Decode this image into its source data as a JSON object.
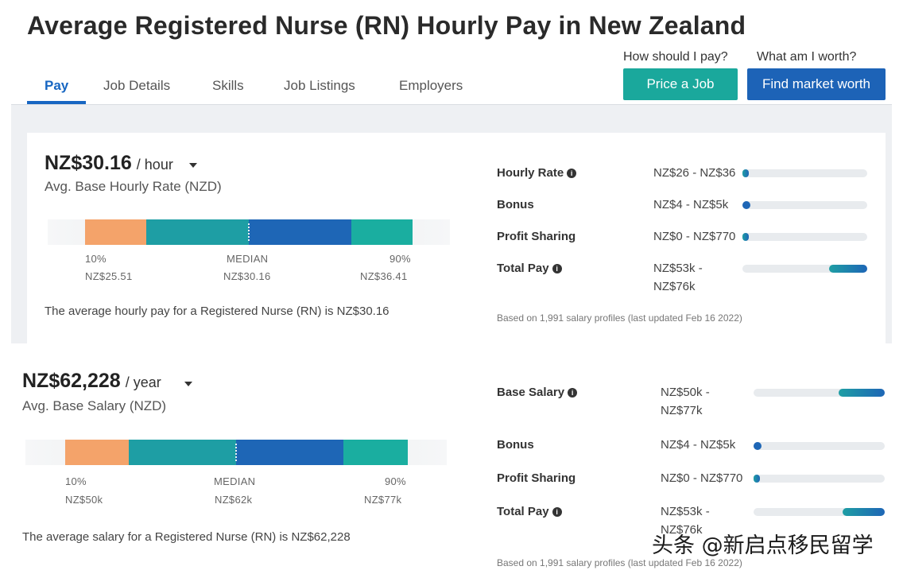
{
  "page": {
    "title": "Average Registered Nurse (RN) Hourly Pay in New Zealand"
  },
  "tabs": [
    {
      "label": "Pay",
      "active": true
    },
    {
      "label": "Job Details",
      "active": false
    },
    {
      "label": "Skills",
      "active": false
    },
    {
      "label": "Job Listings",
      "active": false
    },
    {
      "label": "Employers",
      "active": false
    }
  ],
  "cta": {
    "price_question": "How should I pay?",
    "price_button": "Price a Job",
    "worth_question": "What am I worth?",
    "worth_button": "Find market worth"
  },
  "hourly": {
    "value": "NZ$30.16",
    "unit": "/ hour",
    "label": "Avg. Base Hourly Rate (NZD)",
    "p10_label": "10%",
    "median_label": "MEDIAN",
    "p90_label": "90%",
    "p10_value": "NZ$25.51",
    "median_value": "NZ$30.16",
    "p90_value": "NZ$36.41",
    "summary": "The average hourly pay for a Registered Nurse (RN) is NZ$30.16",
    "rows": [
      {
        "label": "Hourly Rate",
        "info": true,
        "range": "NZ$26 - NZ$36",
        "fill_start": 0.0,
        "fill_end": 0.05
      },
      {
        "label": "Bonus",
        "info": false,
        "range": "NZ$4 - NZ$5k",
        "fill_start": 0.0,
        "fill_end": 0.07
      },
      {
        "label": "Profit Sharing",
        "info": false,
        "range": "NZ$0 - NZ$770",
        "fill_start": 0.0,
        "fill_end": 0.05
      },
      {
        "label": "Total Pay",
        "info": true,
        "range": "NZ$53k -\nNZ$76k",
        "fill_start": 0.7,
        "fill_end": 1.0
      }
    ],
    "footnote": "Based on 1,991 salary profiles (last updated Feb 16 2022)"
  },
  "annual": {
    "value": "NZ$62,228",
    "unit": "/ year",
    "label": "Avg. Base Salary (NZD)",
    "p10_label": "10%",
    "median_label": "MEDIAN",
    "p90_label": "90%",
    "p10_value": "NZ$50k",
    "median_value": "NZ$62k",
    "p90_value": "NZ$77k",
    "summary": "The average salary for a Registered Nurse (RN) is NZ$62,228",
    "rows": [
      {
        "label": "Base Salary",
        "info": true,
        "range": "NZ$50k -\nNZ$77k",
        "fill_start": 0.65,
        "fill_end": 1.0
      },
      {
        "label": "Bonus",
        "info": false,
        "range": "NZ$4 - NZ$5k",
        "fill_start": 0.0,
        "fill_end": 0.07
      },
      {
        "label": "Profit Sharing",
        "info": false,
        "range": "NZ$0 - NZ$770",
        "fill_start": 0.0,
        "fill_end": 0.05
      },
      {
        "label": "Total Pay",
        "info": true,
        "range": "NZ$53k -\nNZ$76k",
        "fill_start": 0.68,
        "fill_end": 1.0
      }
    ],
    "footnote": "Based on 1,991 salary profiles (last updated Feb 16 2022)"
  },
  "watermark": "头条 @新启点移民留学",
  "colors": {
    "accent_blue": "#1766c2",
    "teal_button": "#1aa89c",
    "blue_button": "#1d63b7",
    "low_segment": "#f4a36a",
    "mid_segment": "#1e9ea4",
    "median_segment": "#1e66b6"
  }
}
